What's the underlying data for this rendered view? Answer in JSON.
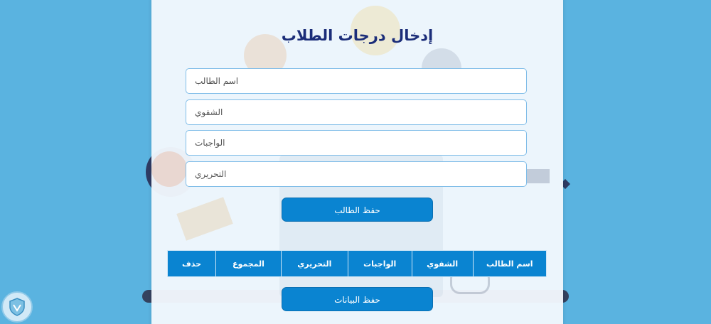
{
  "page": {
    "title": "إدخال درجات الطلاب"
  },
  "form": {
    "student_name_placeholder": "اسم الطالب",
    "oral_placeholder": "الشفوي",
    "homework_placeholder": "الواجبات",
    "written_placeholder": "التحريري",
    "save_student_label": "حفظ الطالب"
  },
  "table": {
    "headers": [
      "اسم الطالب",
      "الشفوي",
      "الواجبات",
      "التحريري",
      "المجموع",
      "حذف"
    ]
  },
  "actions": {
    "save_data_label": "حفظ البيانات"
  },
  "colors": {
    "background": "#5ab3e0",
    "accent": "#0a84d1",
    "title": "#1b2d79"
  },
  "icons": {
    "logo": "shield-logo-icon"
  }
}
